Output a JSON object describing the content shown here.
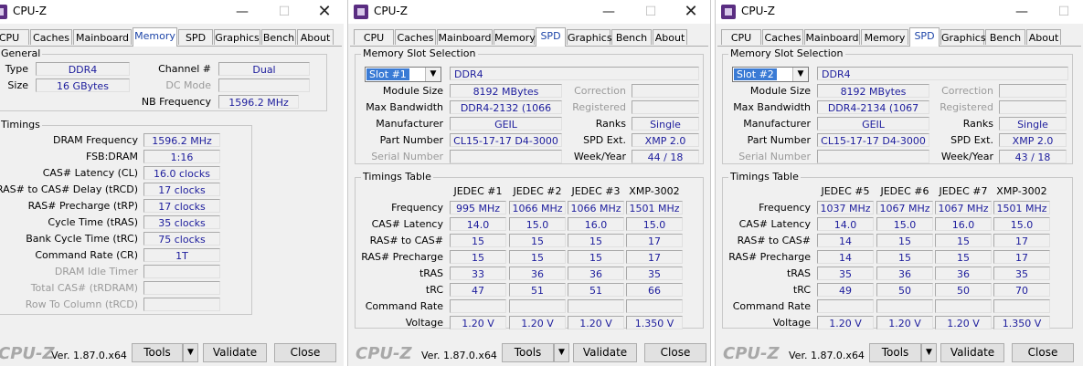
{
  "windows": [
    {
      "title": "CPU-Z",
      "tabs": [
        "CPU",
        "Caches",
        "Mainboard",
        "Memory",
        "SPD",
        "Graphics",
        "Bench",
        "About"
      ],
      "active_tab": "Memory",
      "general": {
        "group_title": "General",
        "type_label": "Type",
        "type_value": "DDR4",
        "size_label": "Size",
        "size_value": "16 GBytes",
        "channel_label": "Channel #",
        "channel_value": "Dual",
        "dcmode_label": "DC Mode",
        "dcmode_value": "",
        "nbfreq_label": "NB Frequency",
        "nbfreq_value": "1596.2 MHz"
      },
      "timings": {
        "group_title": "Timings",
        "rows": [
          {
            "label": "DRAM Frequency",
            "value": "1596.2 MHz",
            "enabled": true
          },
          {
            "label": "FSB:DRAM",
            "value": "1:16",
            "enabled": true
          },
          {
            "label": "CAS# Latency (CL)",
            "value": "16.0 clocks",
            "enabled": true
          },
          {
            "label": "RAS# to CAS# Delay (tRCD)",
            "value": "17 clocks",
            "enabled": true
          },
          {
            "label": "RAS# Precharge (tRP)",
            "value": "17 clocks",
            "enabled": true
          },
          {
            "label": "Cycle Time (tRAS)",
            "value": "35 clocks",
            "enabled": true
          },
          {
            "label": "Bank Cycle Time (tRC)",
            "value": "75 clocks",
            "enabled": true
          },
          {
            "label": "Command Rate (CR)",
            "value": "1T",
            "enabled": true
          },
          {
            "label": "DRAM Idle Timer",
            "value": "",
            "enabled": false
          },
          {
            "label": "Total CAS# (tRDRAM)",
            "value": "",
            "enabled": false
          },
          {
            "label": "Row To Column (tRCD)",
            "value": "",
            "enabled": false
          }
        ]
      },
      "footer": {
        "logo": "CPU-Z",
        "version": "Ver. 1.87.0.x64",
        "tools": "Tools",
        "validate": "Validate",
        "close": "Close"
      }
    },
    {
      "title": "CPU-Z",
      "tabs": [
        "CPU",
        "Caches",
        "Mainboard",
        "Memory",
        "SPD",
        "Graphics",
        "Bench",
        "About"
      ],
      "active_tab": "SPD",
      "slot": {
        "group_title": "Memory Slot Selection",
        "slot_value": "Slot #1",
        "type_value": "DDR4",
        "left_rows": [
          {
            "label": "Module Size",
            "value": "8192 MBytes",
            "enabled": true
          },
          {
            "label": "Max Bandwidth",
            "value": "DDR4-2132 (1066 MHz)",
            "enabled": true
          },
          {
            "label": "Manufacturer",
            "value": "GEIL",
            "enabled": true
          },
          {
            "label": "Part Number",
            "value": "CL15-17-17 D4-3000",
            "enabled": true
          },
          {
            "label": "Serial Number",
            "value": "",
            "enabled": false
          }
        ],
        "right_rows": [
          {
            "label": "Correction",
            "value": "",
            "enabled": false
          },
          {
            "label": "Registered",
            "value": "",
            "enabled": false
          },
          {
            "label": "Ranks",
            "value": "Single",
            "enabled": true
          },
          {
            "label": "SPD Ext.",
            "value": "XMP 2.0",
            "enabled": true
          },
          {
            "label": "Week/Year",
            "value": "44 / 18",
            "enabled": true
          }
        ]
      },
      "timings_table": {
        "group_title": "Timings Table",
        "columns": [
          "JEDEC #1",
          "JEDEC #2",
          "JEDEC #3",
          "XMP-3002"
        ],
        "rows": [
          {
            "label": "Frequency",
            "values": [
              "995 MHz",
              "1066 MHz",
              "1066 MHz",
              "1501 MHz"
            ]
          },
          {
            "label": "CAS# Latency",
            "values": [
              "14.0",
              "15.0",
              "16.0",
              "15.0"
            ]
          },
          {
            "label": "RAS# to CAS#",
            "values": [
              "15",
              "15",
              "15",
              "17"
            ]
          },
          {
            "label": "RAS# Precharge",
            "values": [
              "15",
              "15",
              "15",
              "17"
            ]
          },
          {
            "label": "tRAS",
            "values": [
              "33",
              "36",
              "36",
              "35"
            ]
          },
          {
            "label": "tRC",
            "values": [
              "47",
              "51",
              "51",
              "66"
            ]
          },
          {
            "label": "Command Rate",
            "values": [
              "",
              "",
              "",
              ""
            ]
          },
          {
            "label": "Voltage",
            "values": [
              "1.20 V",
              "1.20 V",
              "1.20 V",
              "1.350 V"
            ]
          }
        ]
      },
      "footer": {
        "logo": "CPU-Z",
        "version": "Ver. 1.87.0.x64",
        "tools": "Tools",
        "validate": "Validate",
        "close": "Close"
      }
    },
    {
      "title": "CPU-Z",
      "tabs": [
        "CPU",
        "Caches",
        "Mainboard",
        "Memory",
        "SPD",
        "Graphics",
        "Bench",
        "About"
      ],
      "active_tab": "SPD",
      "slot": {
        "group_title": "Memory Slot Selection",
        "slot_value": "Slot #2",
        "type_value": "DDR4",
        "left_rows": [
          {
            "label": "Module Size",
            "value": "8192 MBytes",
            "enabled": true
          },
          {
            "label": "Max Bandwidth",
            "value": "DDR4-2134 (1067 MHz)",
            "enabled": true
          },
          {
            "label": "Manufacturer",
            "value": "GEIL",
            "enabled": true
          },
          {
            "label": "Part Number",
            "value": "CL15-17-17 D4-3000",
            "enabled": true
          },
          {
            "label": "Serial Number",
            "value": "",
            "enabled": false
          }
        ],
        "right_rows": [
          {
            "label": "Correction",
            "value": "",
            "enabled": false
          },
          {
            "label": "Registered",
            "value": "",
            "enabled": false
          },
          {
            "label": "Ranks",
            "value": "Single",
            "enabled": true
          },
          {
            "label": "SPD Ext.",
            "value": "XMP 2.0",
            "enabled": true
          },
          {
            "label": "Week/Year",
            "value": "43 / 18",
            "enabled": true
          }
        ]
      },
      "timings_table": {
        "group_title": "Timings Table",
        "columns": [
          "JEDEC #5",
          "JEDEC #6",
          "JEDEC #7",
          "XMP-3002"
        ],
        "rows": [
          {
            "label": "Frequency",
            "values": [
              "1037 MHz",
              "1067 MHz",
              "1067 MHz",
              "1501 MHz"
            ]
          },
          {
            "label": "CAS# Latency",
            "values": [
              "14.0",
              "15.0",
              "16.0",
              "15.0"
            ]
          },
          {
            "label": "RAS# to CAS#",
            "values": [
              "14",
              "15",
              "15",
              "17"
            ]
          },
          {
            "label": "RAS# Precharge",
            "values": [
              "14",
              "15",
              "15",
              "17"
            ]
          },
          {
            "label": "tRAS",
            "values": [
              "35",
              "36",
              "36",
              "35"
            ]
          },
          {
            "label": "tRC",
            "values": [
              "49",
              "50",
              "50",
              "70"
            ]
          },
          {
            "label": "Command Rate",
            "values": [
              "",
              "",
              "",
              ""
            ]
          },
          {
            "label": "Voltage",
            "values": [
              "1.20 V",
              "1.20 V",
              "1.20 V",
              "1.350 V"
            ]
          }
        ]
      },
      "footer": {
        "logo": "CPU-Z",
        "version": "Ver. 1.87.0.x64",
        "tools": "Tools",
        "validate": "Validate",
        "close": "Close"
      }
    }
  ]
}
